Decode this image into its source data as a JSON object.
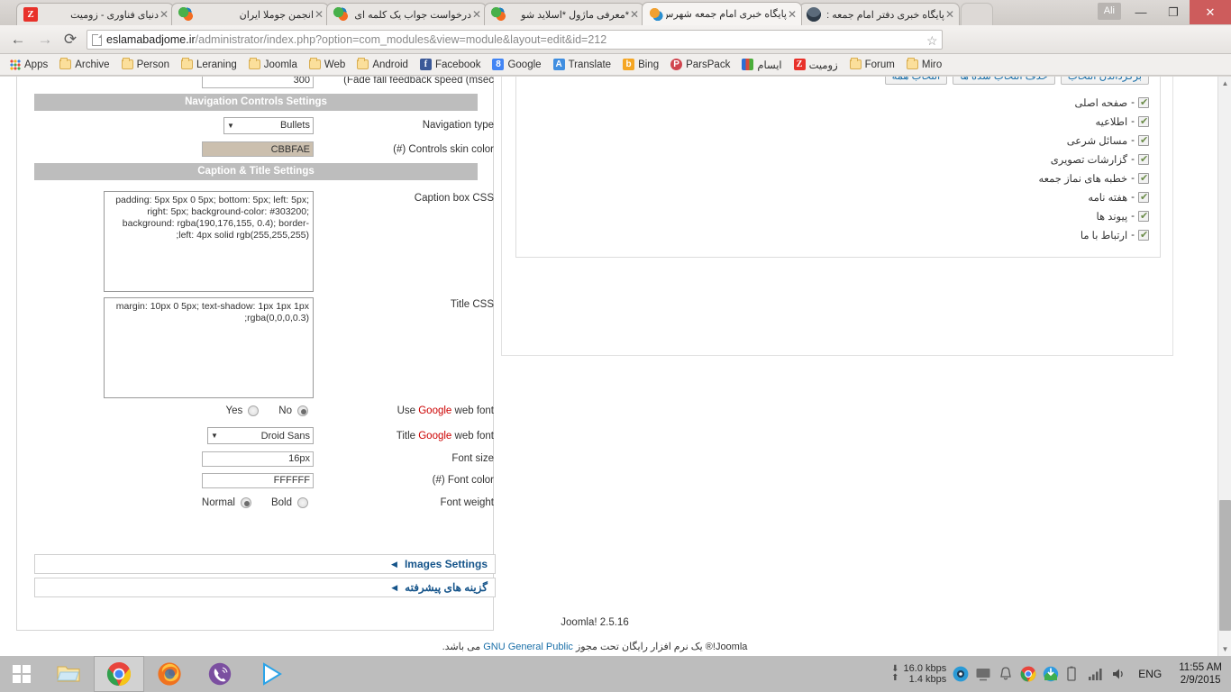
{
  "browser": {
    "tabs": [
      {
        "title": "دنیای فناوری - زومیت",
        "favicon": "zoomit-icon",
        "active": false
      },
      {
        "title": "انجمن جوملا ایران",
        "favicon": "joomla-icon",
        "active": false
      },
      {
        "title": "درخواست جواب یک کلمه ای",
        "favicon": "joomla-icon",
        "active": false
      },
      {
        "title": "*معرفی ماژول *اسلاید شو",
        "favicon": "joomla-icon",
        "active": false
      },
      {
        "title": "پایگاه خبری امام جمعه شهرس",
        "favicon": "joomla-x-icon",
        "active": true
      },
      {
        "title": "پایگاه خبری دفتر امام جمعه :",
        "favicon": "photo-icon",
        "active": false
      }
    ],
    "url_bold": "eslamabadjome.ir",
    "url_rest": "/administrator/index.php?option=com_modules&view=module&layout=edit&id=212",
    "nav": {
      "back": "←",
      "forward": "→",
      "reload": "⟳"
    },
    "extensions": [
      "mail-icon",
      "joomla-extension-icon",
      "eyedropper-icon",
      "note-capture-icon",
      "adblock-icon",
      "adguard-shield-icon",
      "satellite-icon",
      "rss-icon",
      "chrome-menu-icon"
    ],
    "bookmarks": [
      {
        "label": "Apps",
        "icon": "apps-grid-icon"
      },
      {
        "label": "Archive",
        "icon": "folder-icon"
      },
      {
        "label": "Person",
        "icon": "folder-icon"
      },
      {
        "label": "Leraning",
        "icon": "folder-icon"
      },
      {
        "label": "Joomla",
        "icon": "folder-icon"
      },
      {
        "label": "Web",
        "icon": "folder-icon"
      },
      {
        "label": "Android",
        "icon": "folder-icon"
      },
      {
        "label": "Facebook",
        "icon": "facebook-icon"
      },
      {
        "label": "Google",
        "icon": "google-icon"
      },
      {
        "label": "Translate",
        "icon": "translate-icon"
      },
      {
        "label": "Bing",
        "icon": "bing-icon"
      },
      {
        "label": "ParsPack",
        "icon": "parspack-icon"
      },
      {
        "label": "ایسام",
        "icon": "esam-icon"
      },
      {
        "label": "زومیت",
        "icon": "zoomit-icon"
      },
      {
        "label": "Forum",
        "icon": "folder-icon"
      },
      {
        "label": "Miro",
        "icon": "folder-icon"
      }
    ],
    "window": {
      "minimize": "—",
      "maximize": "❐",
      "close": "✕",
      "user": "Ali"
    }
  },
  "page": {
    "fade_fall": {
      "label": "(Fade fall feedback speed (msec",
      "value": "300"
    },
    "section_navigation": "Navigation Controls Settings",
    "navigation_type": {
      "label": "Navigation type",
      "value": "Bullets"
    },
    "controls_skin_color": {
      "label": "(#) Controls skin color",
      "value": "CBBFAE",
      "swatch": "#cbbfae"
    },
    "section_caption": "Caption & Title Settings",
    "caption_box_css": {
      "label": "Caption box CSS",
      "value": "padding: 5px 5px 0 5px; bottom: 5px; left: 5px; right: 5px; background-color: #303200; background: rgba(190,176,155, 0.4); border-left: 4px solid rgb(255,255,255);"
    },
    "title_css": {
      "label": "Title CSS",
      "value": "margin: 10px 0 5px; text-shadow: 1px 1px 1px rgba(0,0,0,0.3);"
    },
    "use_google_web_font": {
      "label_pre": "Use ",
      "label_brand": "Google",
      "label_post": " web font",
      "yes": "Yes",
      "no": "No",
      "selected": "No"
    },
    "title_google_web_font": {
      "label_pre": "Title ",
      "label_brand": "Google",
      "label_post": " web font",
      "value": "Droid Sans"
    },
    "font_size": {
      "label": "Font size",
      "value": "16px"
    },
    "font_color": {
      "label": "(#) Font color",
      "value": "FFFFFF"
    },
    "font_weight": {
      "label": "Font weight",
      "normal": "Normal",
      "bold": "Bold",
      "selected": "Normal"
    },
    "collapsed_sections": [
      {
        "title": "Images Settings",
        "arrow": "◀"
      },
      {
        "title": "گزینه های پیشرفته",
        "arrow": "◀"
      }
    ],
    "menu_assignment": {
      "buttons": [
        "برگرداندن انتخاب",
        "حذف انتخاب شده ها",
        "انتخاب همه"
      ],
      "items": [
        {
          "label": "صفحه اصلی",
          "checked": true
        },
        {
          "label": "اطلاعیه",
          "checked": true
        },
        {
          "label": "مسائل شرعی",
          "checked": true
        },
        {
          "label": "گزارشات تصویری",
          "checked": true
        },
        {
          "label": "خطبه های نماز جمعه",
          "checked": true
        },
        {
          "label": "هفته نامه",
          "checked": true
        },
        {
          "label": "پیوند ها",
          "checked": true
        },
        {
          "label": "ارتباط با ما",
          "checked": true
        }
      ]
    },
    "footer": {
      "version": "Joomla! 2.5.16",
      "license_pre": "Joomla!® یک نرم افزار رایگان تحت مجوز ",
      "license_link": "GNU General Public",
      "license_post": " می باشد."
    }
  },
  "taskbar": {
    "apps": [
      "file-explorer-icon",
      "chrome-icon",
      "firefox-icon",
      "viber-icon",
      "media-player-icon"
    ],
    "network": {
      "down": "16.0 kbps",
      "up": "1.4 kbps"
    },
    "tray_icons": [
      "viber-tray-icon",
      "display-icon",
      "notification-bell-icon",
      "chrome-tray-icon",
      "idm-icon",
      "battery-icon",
      "signal-icon",
      "volume-icon"
    ],
    "language": "ENG",
    "time": "11:55 AM",
    "date": "2/9/2015"
  }
}
